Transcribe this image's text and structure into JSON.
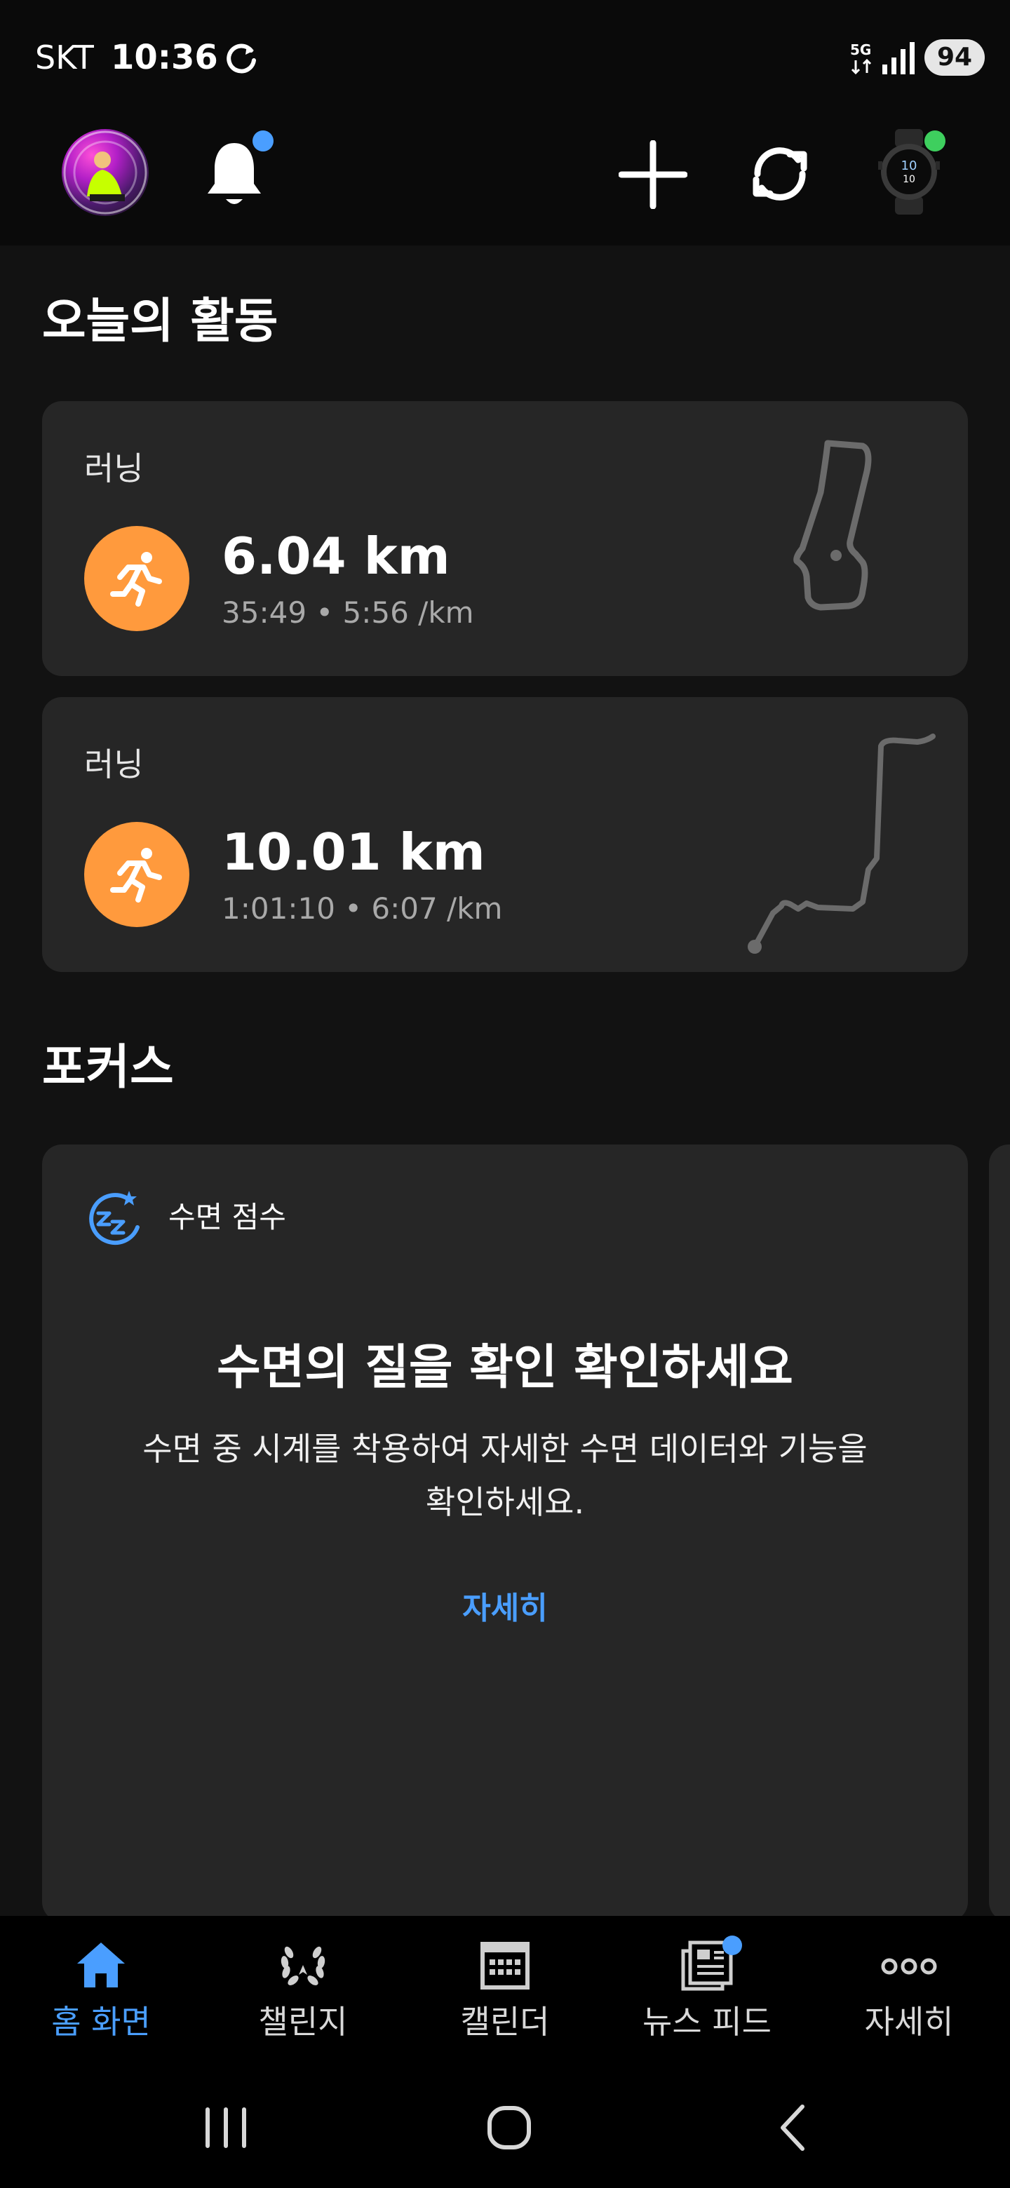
{
  "status_bar": {
    "carrier": "SKT",
    "time": "10:36",
    "battery": "94",
    "icons": [
      "sync-status-icon",
      "5g-icon",
      "signal-icon",
      "battery-icon"
    ]
  },
  "top_bar": {
    "icons": [
      "avatar",
      "bell-icon",
      "add-icon",
      "sync-icon",
      "watch-icon"
    ],
    "notification_dot_color": "#4a9eff",
    "device_connected_dot_color": "#3ecf5e"
  },
  "today": {
    "title": "오늘의 활동",
    "activities": [
      {
        "type": "러닝",
        "distance": "6.04 km",
        "meta": "35:49 • 5:56 /km",
        "icon": "running-icon"
      },
      {
        "type": "러닝",
        "distance": "10.01 km",
        "meta": "1:01:10 • 6:07 /km",
        "icon": "running-icon"
      }
    ]
  },
  "focus": {
    "title": "포커스",
    "card": {
      "label": "수면 점수",
      "heading": "수면의 질을 확인 확인하세요",
      "body": "수면 중 시계를 착용하여 자세한 수면 데이터와 기능을 확인하세요.",
      "link": "자세히"
    }
  },
  "bottom_nav": {
    "items": [
      {
        "label": "홈 화면",
        "icon": "home-icon",
        "active": true
      },
      {
        "label": "챌린지",
        "icon": "laurel-icon",
        "active": false
      },
      {
        "label": "캘린더",
        "icon": "calendar-icon",
        "active": false
      },
      {
        "label": "뉴스 피드",
        "icon": "news-icon",
        "active": false
      },
      {
        "label": "자세히",
        "icon": "more-icon",
        "active": false
      }
    ]
  },
  "colors": {
    "background": "#121212",
    "card": "#262626",
    "accent_blue": "#4a9eff",
    "activity_orange": "#ff9a3d"
  }
}
